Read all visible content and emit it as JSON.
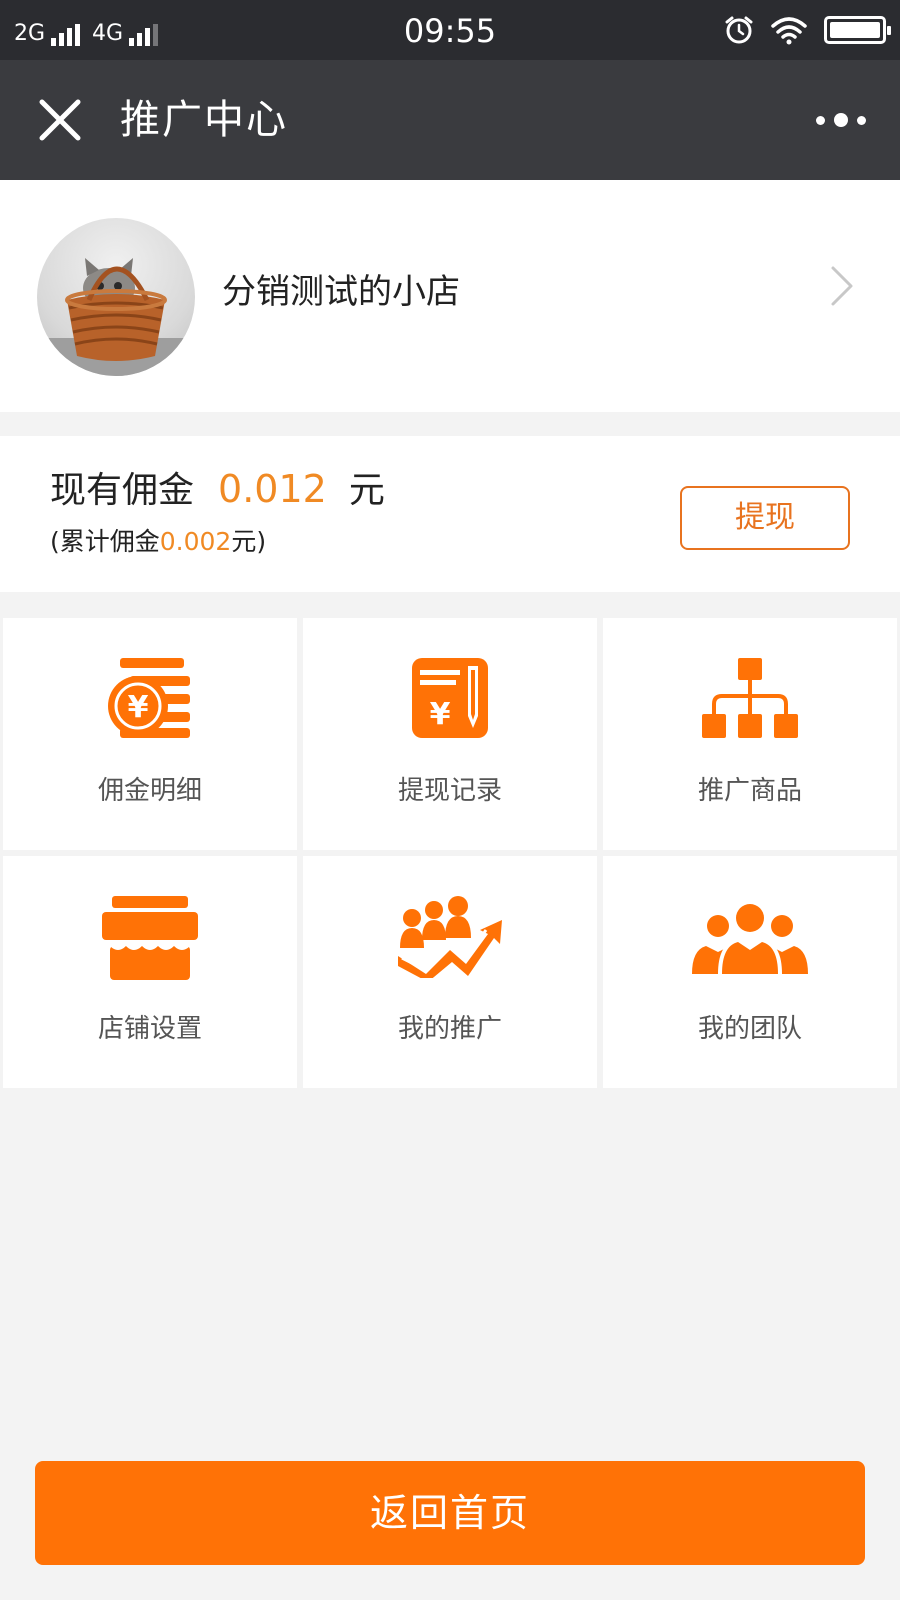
{
  "status_bar": {
    "net1": "2G",
    "net2": "4G",
    "time": "09:55"
  },
  "nav": {
    "title": "推广中心"
  },
  "profile": {
    "shop_name": "分销测试的小店"
  },
  "commission": {
    "label": "现有佣金",
    "amount": "0.012",
    "unit": "元",
    "total_prefix": "(累计佣金",
    "total_amount": "0.002",
    "total_suffix": "元)",
    "withdraw_label": "提现"
  },
  "menu": [
    {
      "label": "佣金明细",
      "icon": "coin-stack-icon"
    },
    {
      "label": "提现记录",
      "icon": "withdraw-record-icon"
    },
    {
      "label": "推广商品",
      "icon": "org-tree-icon"
    },
    {
      "label": "店铺设置",
      "icon": "storefront-icon"
    },
    {
      "label": "我的推广",
      "icon": "growth-people-icon"
    },
    {
      "label": "我的团队",
      "icon": "team-icon"
    }
  ],
  "home_button": "返回首页",
  "colors": {
    "accent": "#ff7206",
    "nav_bg": "#3a3b3f",
    "status_bg": "#2b2c30",
    "amount": "#f08a24"
  }
}
